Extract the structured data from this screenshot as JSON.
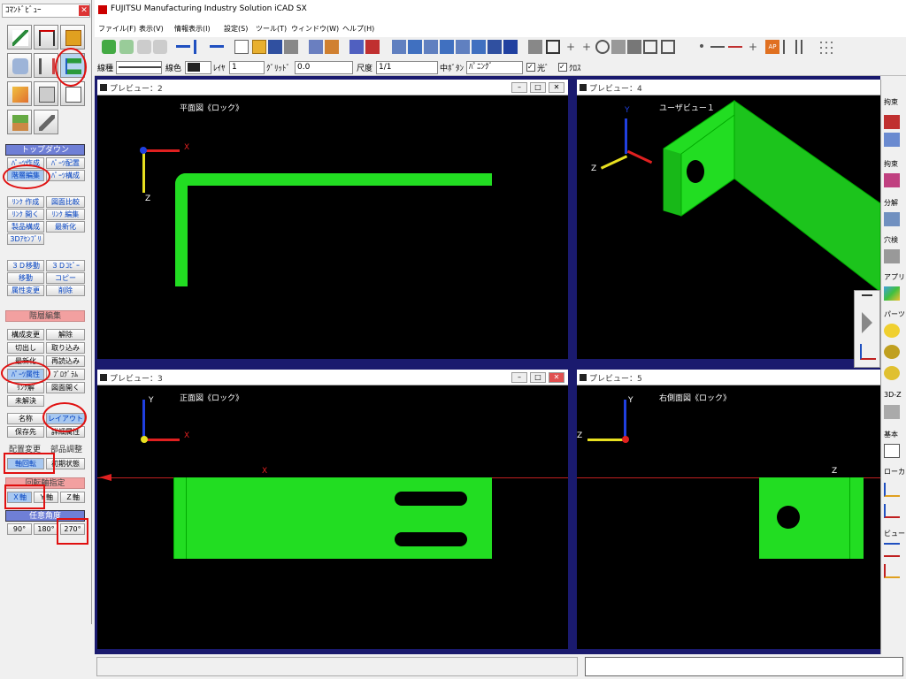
{
  "command_view": {
    "title": "ｺﾏﾝﾄﾞﾋﾞｭｰ",
    "close": "✕",
    "top_down": "トップダウン",
    "row1": [
      "ﾊﾟｰﾂ作成",
      "ﾊﾟｰﾂ配置"
    ],
    "row2": [
      "階層編集",
      "ﾊﾟｰﾂ構成"
    ],
    "row3": [
      "ﾘﾝｸ 作成",
      "図面比較"
    ],
    "row4": [
      "ﾘﾝｸ 開く",
      "ﾘﾝｸ 編集"
    ],
    "row5": [
      "製品構成",
      "最新化"
    ],
    "row6": [
      "3Dｱｾﾝﾌﾞﾘ"
    ],
    "row7": [
      "３Ｄ移動",
      "３Ｄｺﾋﾟｰ"
    ],
    "row8": [
      "移動",
      "コピー"
    ],
    "row9": [
      "属性変更",
      "削除"
    ],
    "hier_edit": "階層編集",
    "row10": [
      "構成変更",
      "解除"
    ],
    "row11": [
      "切出し",
      "取り込み"
    ],
    "row12": [
      "最新化",
      "再読込み"
    ],
    "row13": [
      "ﾊﾟｰﾂ属性",
      "ﾌﾟﾛｸﾞﾗﾑ"
    ],
    "row14": [
      "ﾘﾝｸ解",
      "図面開く"
    ],
    "row15": [
      "未解決"
    ],
    "row16": [
      "名称",
      "レイアウト"
    ],
    "row17": [
      "保存先",
      "詳細属性"
    ],
    "sub_a": "配置変更",
    "sub_b": "部品調整",
    "row18": [
      "軸回転",
      "初期状態"
    ],
    "axis_spec": "回転軸指定",
    "row19": [
      "Ｘ軸",
      "Ｙ軸",
      "Ｚ軸"
    ],
    "angle_spec": "任意角度",
    "row20": [
      "90°",
      "180°",
      "270°"
    ]
  },
  "app": {
    "title": "FUJITSU Manufacturing Industry Solution iCAD SX",
    "menus": [
      "ファイル(F)",
      "表示(V)",
      "情報表示(I)",
      "設定(S)",
      "ツール(T)",
      "ウィンドウ(W)",
      "ヘルプ(H)"
    ]
  },
  "props": {
    "line_type_label": "線種",
    "line_color_label": "線色",
    "layer_label": "ﾚｲﾔ",
    "layer_value": "1",
    "grid_label": "ｸﾞﾘｯﾄﾞ",
    "grid_value": "0.0",
    "scale_label": "尺度",
    "scale_value": "1/1",
    "middle_button_label": "中ﾎﾞﾀﾝ",
    "middle_button_value": "ﾊﾟﾆﾝｸﾞ",
    "light_label": "光ﾞ",
    "cross_label": "ｸﾛｽ"
  },
  "viewports": [
    {
      "title": "プレビュー：2",
      "view": "平面図《ロック》",
      "axis_a": "X",
      "axis_b": "Z"
    },
    {
      "title": "プレビュー：4",
      "view": "ユーザビュー１",
      "axis_a": "Y",
      "axis_b": "Z"
    },
    {
      "title": "プレビュー：3",
      "view": "正面図《ロック》",
      "axis_a": "Y",
      "axis_b": "X",
      "marker": "X"
    },
    {
      "title": "プレビュー：5",
      "view": "右側面図《ロック》",
      "axis_a": "Y",
      "axis_b": "Z",
      "marker": "Z"
    }
  ],
  "right_panel": [
    "拘束",
    "拘束",
    "分解",
    "穴検",
    "アプリ",
    "パーツ",
    "3D-Z",
    "基本",
    "ローカ",
    "ビュー"
  ],
  "colors": {
    "part": "#22dd22",
    "viewport_bg": "#000000",
    "frame": "#1a1a6e",
    "highlight": "#e01010"
  }
}
